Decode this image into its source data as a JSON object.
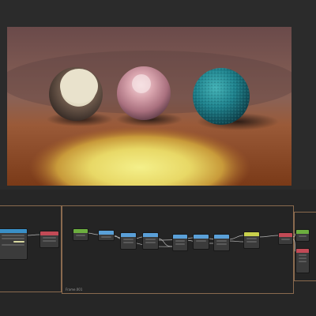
{
  "viewport": {
    "objects": [
      {
        "name": "white-glossy-sphere"
      },
      {
        "name": "pink-glossy-sphere"
      },
      {
        "name": "teal-speckled-sphere"
      }
    ],
    "lighting": "warm-yellow-spotlight"
  },
  "node_editor": {
    "frame_label": "Frame.001",
    "header_colors": {
      "input": "#3a8fc7",
      "vector": "#5aa0d8",
      "texture": "#6cae3f",
      "shader": "#c9d14c",
      "output": "#c24a56",
      "converter": "#8a8a8a"
    },
    "nodes": [
      {
        "id": "left-shader-node",
        "kind": "input"
      },
      {
        "id": "left-output-node",
        "kind": "output"
      },
      {
        "id": "texture-coord-node",
        "kind": "texture"
      },
      {
        "id": "mapping-node",
        "kind": "vector"
      },
      {
        "id": "math-node-1",
        "kind": "vector"
      },
      {
        "id": "math-node-2",
        "kind": "vector"
      },
      {
        "id": "math-node-3",
        "kind": "vector"
      },
      {
        "id": "math-node-4",
        "kind": "vector"
      },
      {
        "id": "math-node-5",
        "kind": "vector"
      },
      {
        "id": "color-ramp-node",
        "kind": "shader"
      },
      {
        "id": "mix-node",
        "kind": "output"
      },
      {
        "id": "right-group-node-1",
        "kind": "texture"
      },
      {
        "id": "right-group-node-2",
        "kind": "output"
      }
    ]
  },
  "colors": {
    "background": "#2b2b2b",
    "frame_border": "#8a6a4e",
    "link": "#cfcfcf"
  }
}
